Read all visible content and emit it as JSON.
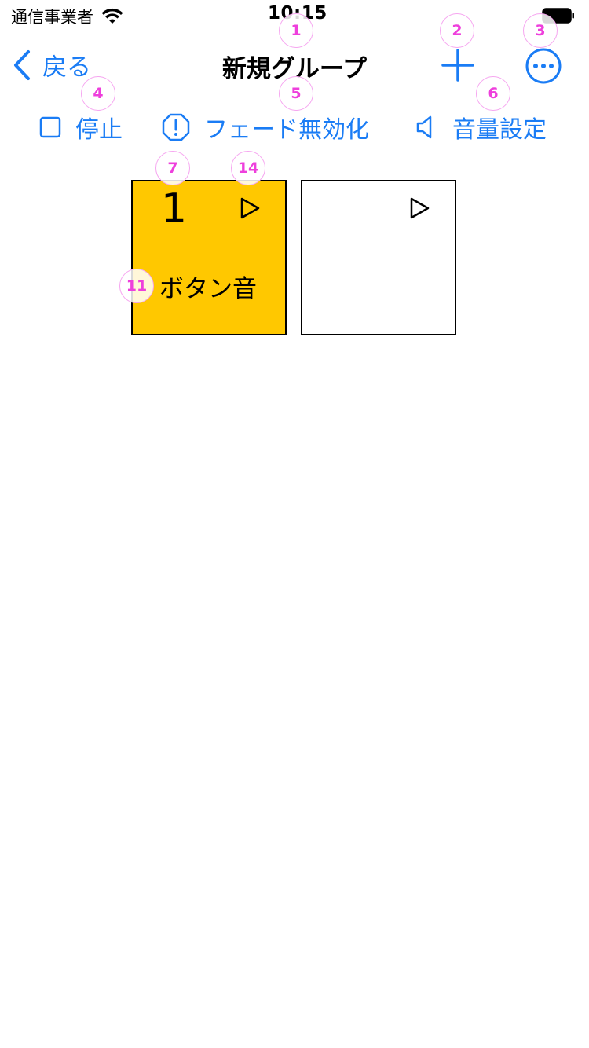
{
  "status_bar": {
    "carrier": "通信事業者",
    "time": "10:15",
    "wifi_icon": "wifi-icon",
    "battery_icon": "battery-icon"
  },
  "nav": {
    "back_label": "戻る",
    "title": "新規グループ",
    "add_icon": "plus-icon",
    "more_icon": "ellipsis-circle-icon"
  },
  "toolbar": {
    "stop_label": "停止",
    "fade_label": "フェード無効化",
    "volume_label": "音量設定"
  },
  "tiles": [
    {
      "number": "1",
      "label": "ボタン音",
      "color": "#ffc800"
    },
    {
      "number": "",
      "label": "",
      "color": "#ffffff"
    }
  ],
  "markers": [
    "1",
    "2",
    "3",
    "4",
    "5",
    "6",
    "7",
    "14",
    "11"
  ],
  "colors": {
    "accent": "#1a7cf5",
    "tile_active": "#ffc800",
    "marker": "#ee3fdc"
  }
}
